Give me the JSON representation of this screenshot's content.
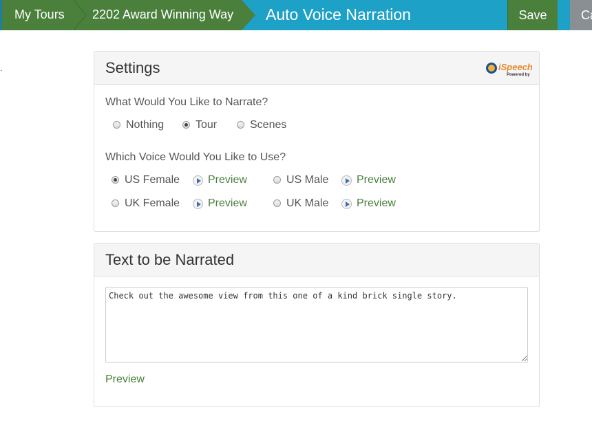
{
  "header": {
    "breadcrumbs": [
      {
        "label": "My Tours"
      },
      {
        "label": "2202 Award Winning Way"
      }
    ],
    "title": "Auto Voice Narration",
    "save_label": "Save",
    "cancel_label": "Ca"
  },
  "settings": {
    "title": "Settings",
    "logo_text": "iSpeech",
    "logo_subtext": "Powered by",
    "narrate_question": "What Would You Like to Narrate?",
    "narrate_options": [
      {
        "label": "Nothing",
        "checked": false
      },
      {
        "label": "Tour",
        "checked": true
      },
      {
        "label": "Scenes",
        "checked": false
      }
    ],
    "voice_question": "Which Voice Would You Like to Use?",
    "voice_options": [
      {
        "label": "US Female",
        "checked": true
      },
      {
        "label": "US Male",
        "checked": false
      },
      {
        "label": "UK Female",
        "checked": false
      },
      {
        "label": "UK Male",
        "checked": false
      }
    ],
    "preview_label": "Preview"
  },
  "narration": {
    "title": "Text to be Narrated",
    "text": "Check out the awesome view from this one of a kind brick single story.",
    "preview_label": "Preview"
  },
  "colors": {
    "topbar": "#1ea1c6",
    "breadcrumb_green": "#4a7f3c",
    "save_green": "#4a7f3c",
    "cancel_gray": "#8a8f93",
    "link_green": "#4a7f3c"
  },
  "stray_mark": "."
}
